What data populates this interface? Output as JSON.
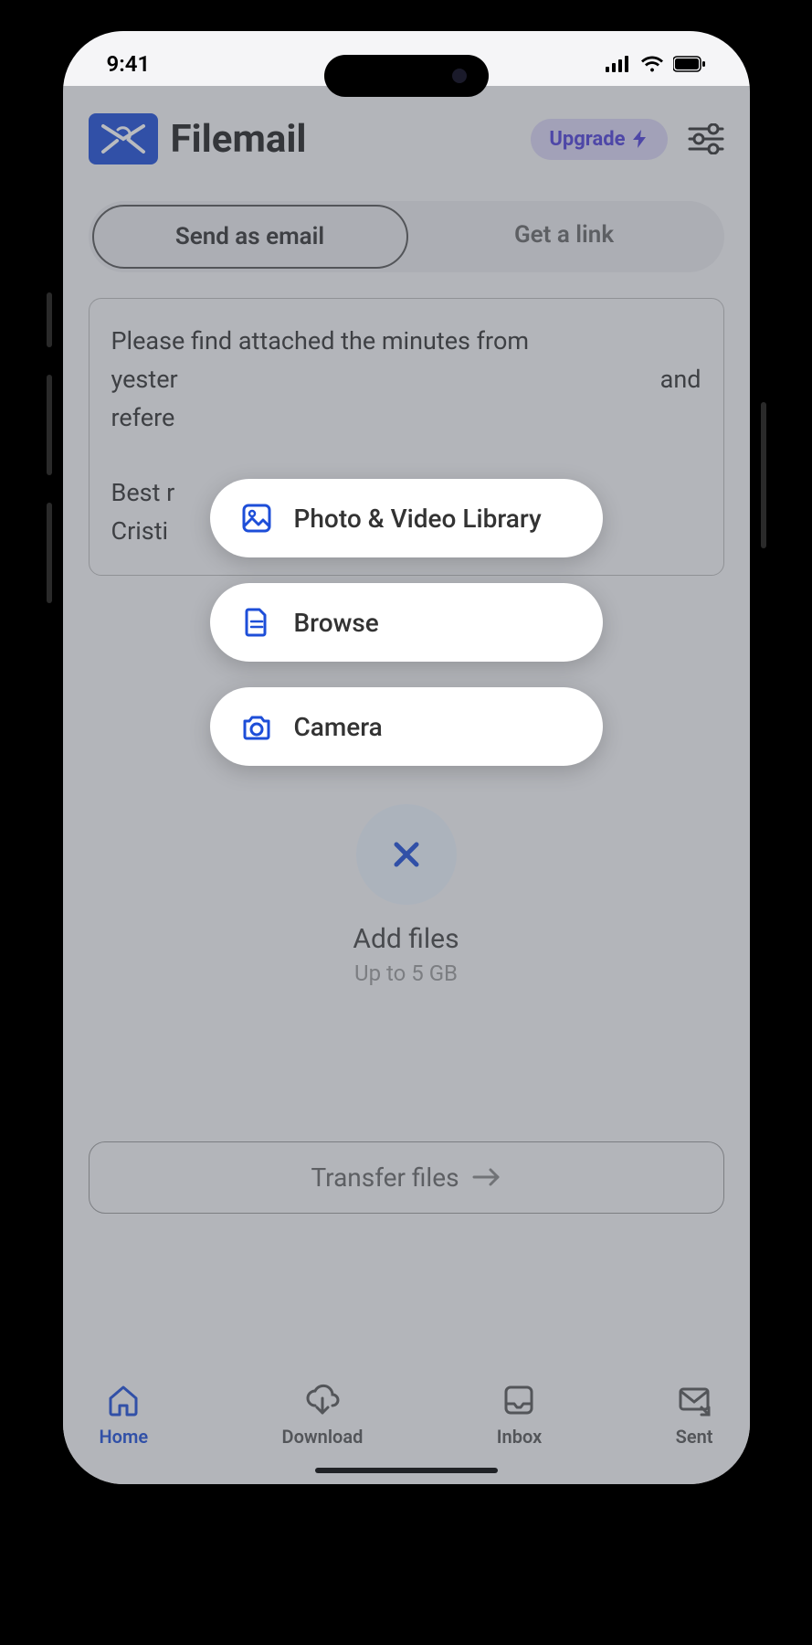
{
  "status": {
    "time": "9:41"
  },
  "header": {
    "brand": "Filemail",
    "upgrade": "Upgrade"
  },
  "toggle": {
    "email": "Send as email",
    "link": "Get a link"
  },
  "message": {
    "line1": "Please find attached the minutes from",
    "line2_left": "yester",
    "line2_right": "and",
    "line3": "refere",
    "line5_left": "Best r",
    "line6": "Cristi"
  },
  "add": {
    "title": "Add files",
    "sub": "Up to 5 GB"
  },
  "transfer": {
    "label": "Transfer files"
  },
  "tabs": {
    "home": "Home",
    "download": "Download",
    "inbox": "Inbox",
    "sent": "Sent"
  },
  "menu": {
    "photo": "Photo & Video Library",
    "browse": "Browse",
    "camera": "Camera"
  }
}
